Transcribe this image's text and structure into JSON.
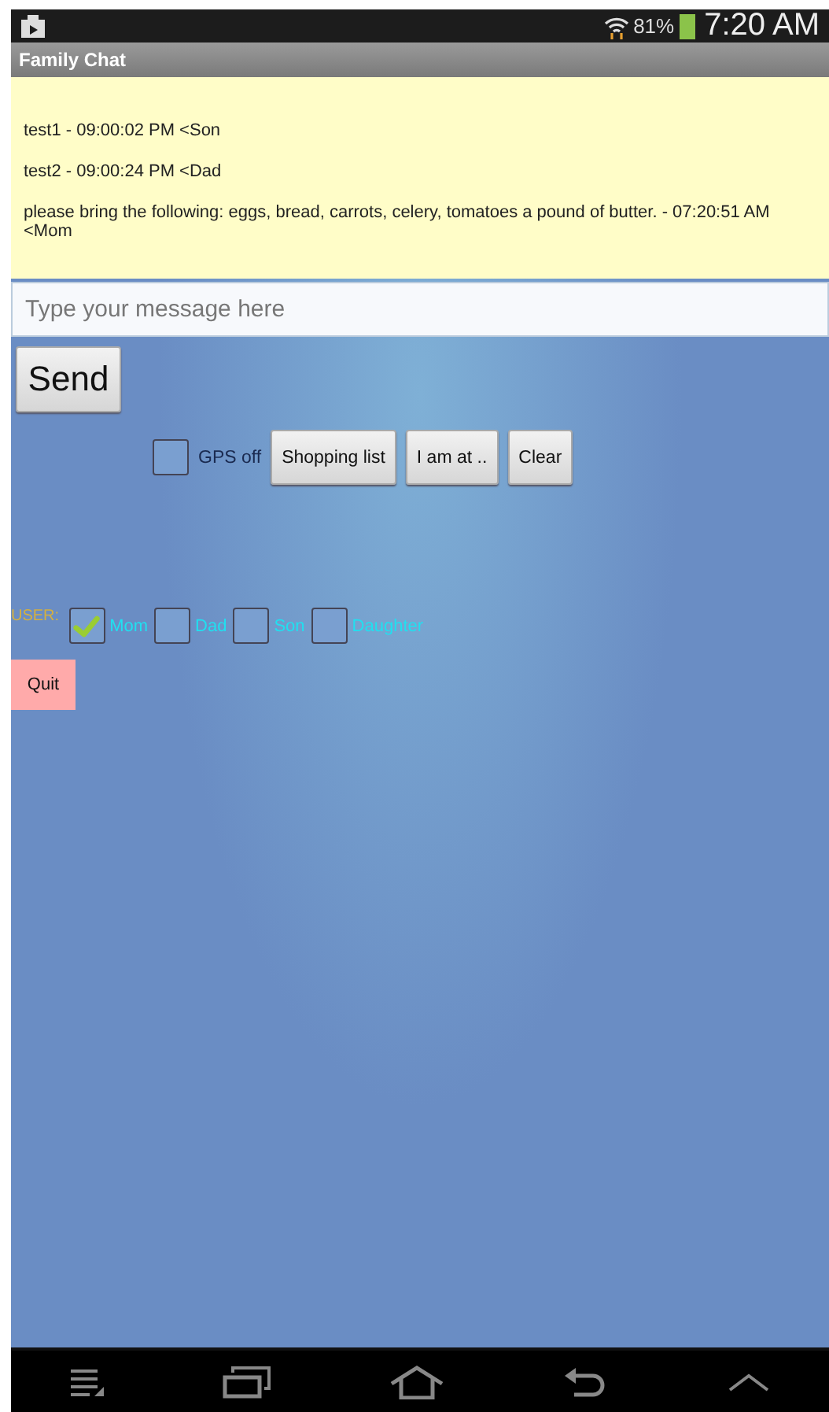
{
  "status_bar": {
    "battery": "81%",
    "time": "7:20 AM"
  },
  "title": "Family Chat",
  "messages": [
    {
      "text": "test1 - 09:00:02 PM  <Son"
    },
    {
      "text": "test2 - 09:00:24 PM  <Dad"
    },
    {
      "text": "please bring the following: eggs, bread, carrots, celery, tomatoes a pound of butter. - 07:20:51 AM  <Mom"
    }
  ],
  "message_input": {
    "placeholder": "Type your message here"
  },
  "send_button": "Send",
  "gps": {
    "label": "GPS off",
    "checked": false
  },
  "buttons": [
    "Shopping list",
    "I am at ..",
    "Clear"
  ],
  "user": {
    "label": "USER:",
    "options": [
      {
        "label": "Mom",
        "checked": true
      },
      {
        "label": "Dad",
        "checked": false
      },
      {
        "label": "Son",
        "checked": false
      },
      {
        "label": "Daughter",
        "checked": false
      }
    ]
  },
  "quit_button": "Quit"
}
